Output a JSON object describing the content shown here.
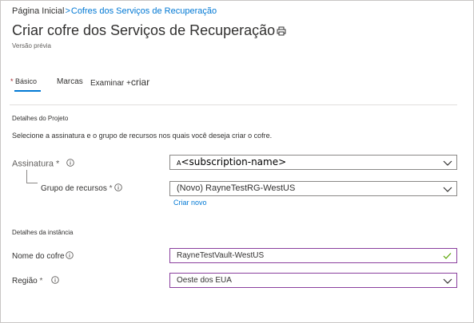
{
  "breadcrumb": {
    "home": "Página Inicial",
    "separator": ">",
    "current": "Cofres dos Serviços de Recuperação"
  },
  "page": {
    "title": "Criar cofre dos Serviços de Recuperação",
    "preview_label": "Versão prévia"
  },
  "tabs": {
    "basics": {
      "required_mark": "*",
      "label": "Básico"
    },
    "tags": {
      "label": "Marcas"
    },
    "review": {
      "label_start": "Examinar ",
      "label_plus": "+",
      "label_end": "criar"
    }
  },
  "project_details": {
    "heading": "Detalhes do Projeto",
    "description": "Selecione a assinatura e o grupo de recursos nos quais você deseja criar o cofre.",
    "subscription": {
      "label": "Assinatura",
      "required_mark": "*",
      "value_prefix": "A",
      "value": "<subscription-name>"
    },
    "resource_group": {
      "label": "Grupo de recursos",
      "required_mark": "*",
      "value": "(Novo) RayneTestRG-WestUS",
      "create_new": "Criar novo"
    }
  },
  "instance_details": {
    "heading": "Detalhes da instância",
    "vault_name": {
      "label": "Nome do cofre",
      "value": "RayneTestVault-WestUS"
    },
    "region": {
      "label": "Região",
      "required_mark": "*",
      "value": "Oeste dos EUA"
    }
  },
  "colors": {
    "accent": "#0078d4",
    "required": "#a4262c",
    "valid": "#57a300",
    "focus_border": "#8a3f9e"
  },
  "icons": [
    "info-icon",
    "chevron-down-icon",
    "checkmark-icon",
    "print-icon"
  ]
}
